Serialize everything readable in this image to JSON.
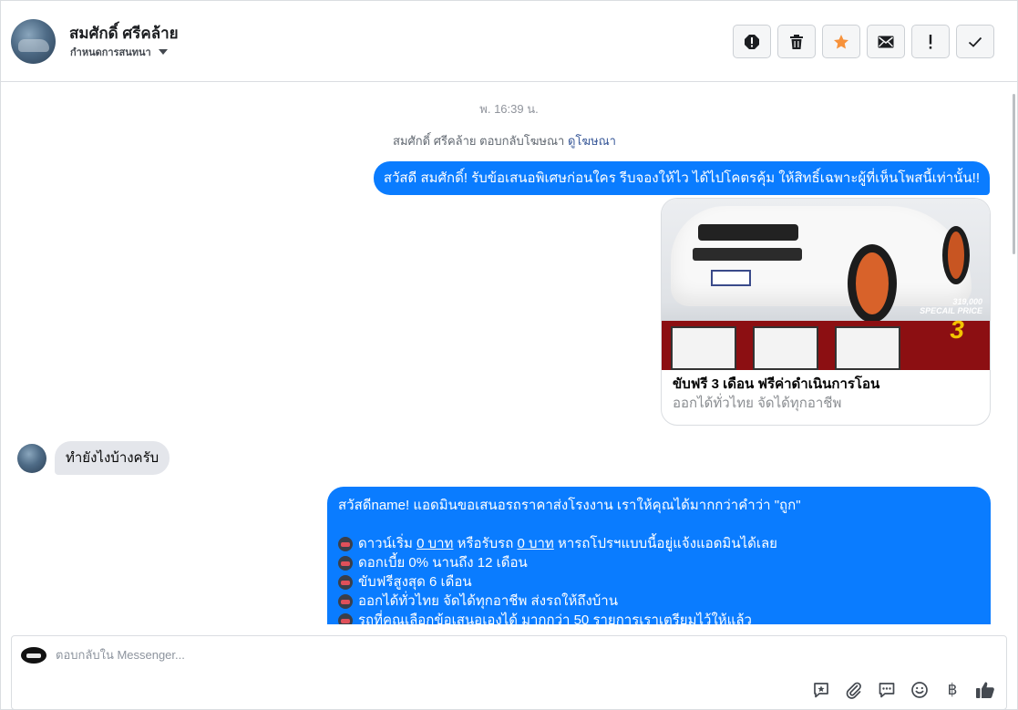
{
  "header": {
    "contact_name": "สมศักดิ์ ศรีคล้าย",
    "conversation_settings": "กำหนดการสนทนา",
    "actions": [
      {
        "name": "spam",
        "icon": "alert-circle-icon"
      },
      {
        "name": "delete",
        "icon": "trash-icon"
      },
      {
        "name": "star",
        "icon": "star-icon",
        "color": "#f7923b"
      },
      {
        "name": "mark-unread",
        "icon": "envelope-icon"
      },
      {
        "name": "follow-up",
        "icon": "exclamation-icon"
      },
      {
        "name": "mark-done",
        "icon": "checkmark-icon"
      }
    ]
  },
  "thread": {
    "timestamp": "พ. 16:39 น.",
    "reply_note_prefix": "สมศักดิ์ ศรีคล้าย ตอบกลับโฆษณา",
    "reply_note_link": "ดูโฆษณา",
    "outgoing_1": "สวัสดี สมศักดิ์! รับข้อเสนอพิเศษก่อนใคร รีบจองให้ไว ได้ไปโคตรคุ้ม ให้สิทธิ์เฉพาะผู้ที่เห็นโพสนี้เท่านั้น!!",
    "ad": {
      "title": "ขับฟรี 3 เดือน ฟรีค่าดำเนินการโอน",
      "subtitle": "ออกได้ทั่วไทย จัดได้ทุกอาชีพ",
      "image_price": "319,000",
      "image_price_label": "SPECAIL PRICE",
      "image_number": "3"
    },
    "incoming_1": "ทำยังไงบ้างครับ",
    "outgoing_2": {
      "greeting": "สวัสดีname! แอดมินขอเสนอรถราคาส่งโรงงาน เราให้คุณได้มากกว่าคำว่า \"ถูก\"",
      "line1_a": "ดาวน์เริ่ม ",
      "line1_u1": "0 บาท",
      "line1_b": " หรือรับรถ ",
      "line1_u2": "0 บาท",
      "line1_c": " หารถโปรฯแบบนี้อยู่แจ้งแอดมินได้เลย",
      "line2": "ดอกเบี้ย 0% นานถึง 12 เดือน",
      "line3": "ขับฟรีสูงสุด 6 เดือน",
      "line4": "ออกได้ทั่วไทย จัดได้ทุกอาชีพ ส่งรถให้ถึงบ้าน",
      "line5": "รถที่คุณเลือกข้อเสนอเองได้ มากกว่า 50 รายการเราเตรียมไว้ให้แล้ว"
    }
  },
  "composer": {
    "placeholder": "ตอบกลับใน Messenger...",
    "tools": [
      "saved-reply-icon",
      "attachment-icon",
      "chat-bubble-icon",
      "emoji-icon",
      "baht-icon",
      "thumbs-up-icon"
    ],
    "baht_symbol": "฿"
  },
  "colors": {
    "accent": "#0a7cff",
    "incoming_bubble": "#e4e6eb",
    "star": "#f7923b"
  }
}
